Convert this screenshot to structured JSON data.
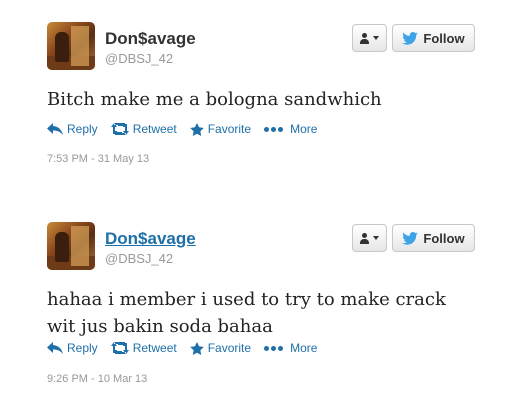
{
  "tweets": [
    {
      "display_name": "Don$avage",
      "handle": "@DBSJ_42",
      "follow_label": "Follow",
      "text": "Bitch make me a bologna sandwhich",
      "actions": {
        "reply": "Reply",
        "retweet": "Retweet",
        "favorite": "Favorite",
        "more": "More"
      },
      "timestamp": "7:53 PM - 31 May 13"
    },
    {
      "display_name": "Don$avage",
      "handle": "@DBSJ_42",
      "follow_label": "Follow",
      "text": "hahaa i member i used to try to make crack wit jus bakin soda bahaa",
      "actions": {
        "reply": "Reply",
        "retweet": "Retweet",
        "favorite": "Favorite",
        "more": "More"
      },
      "timestamp": "9:26 PM - 10 Mar 13"
    }
  ],
  "colors": {
    "link": "#1f6fa8",
    "bird": "#3ea2e6",
    "muted": "#999999"
  },
  "icons": [
    "user-dropdown-icon",
    "twitter-bird-icon",
    "reply-icon",
    "retweet-icon",
    "favorite-star-icon",
    "more-dots-icon"
  ]
}
